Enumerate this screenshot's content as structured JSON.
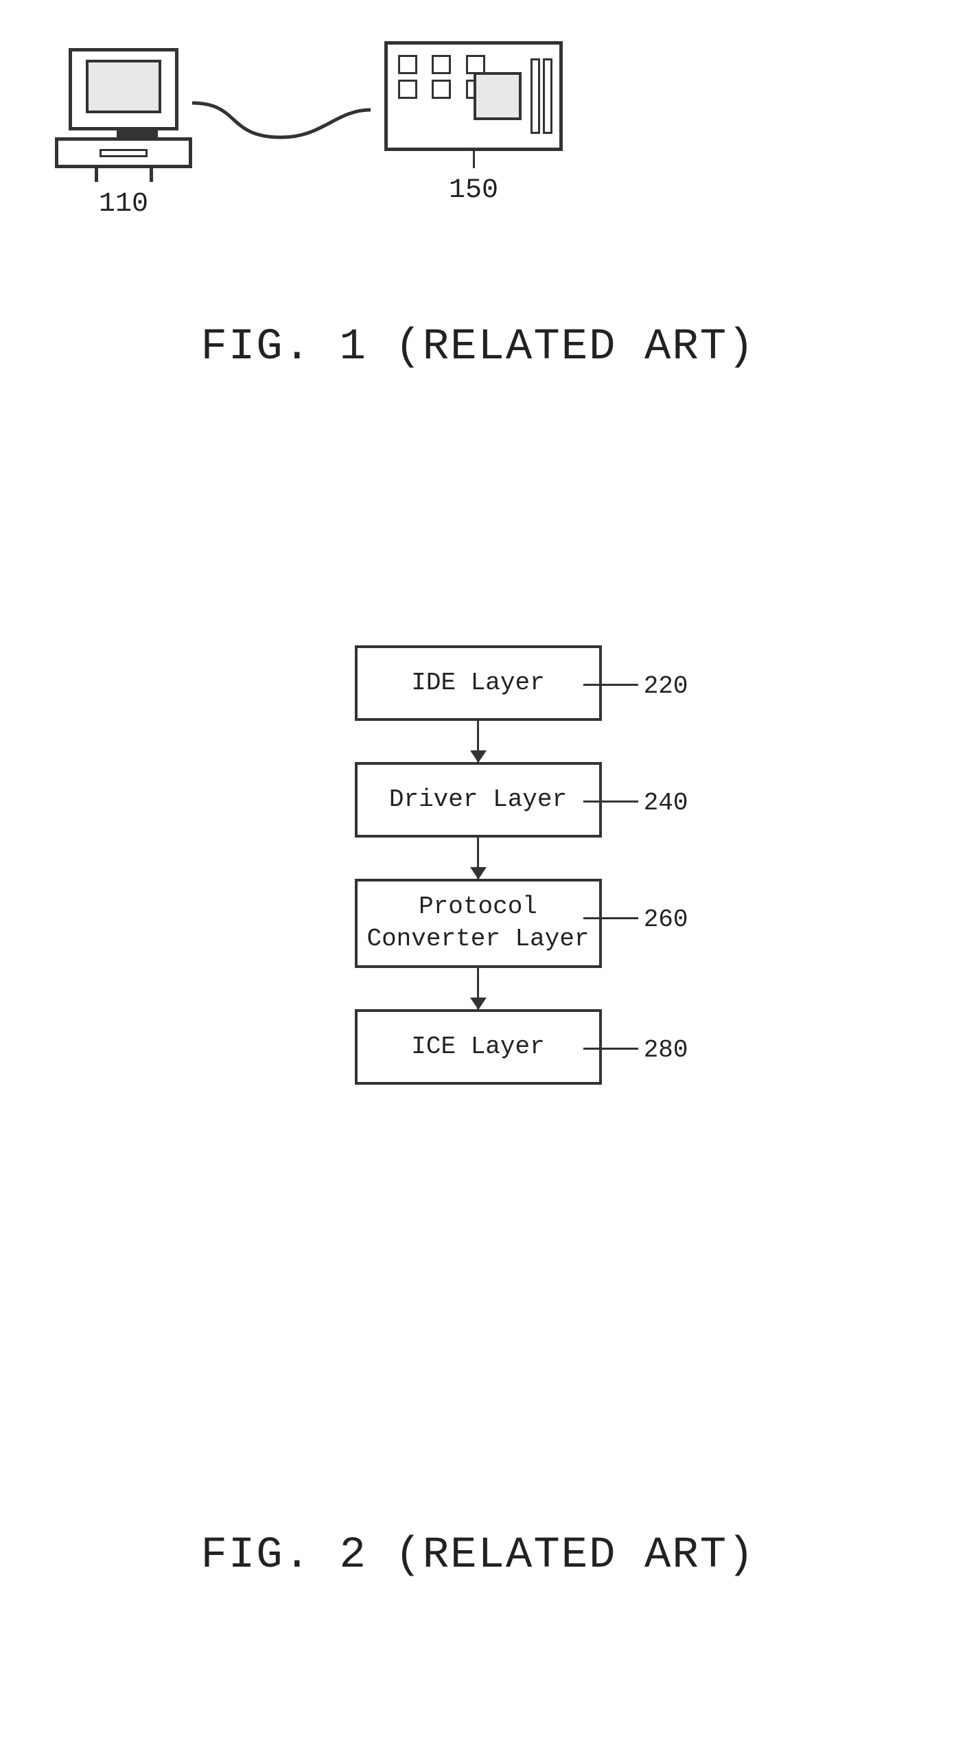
{
  "fig1": {
    "caption": "FIG. 1 (RELATED ART)",
    "device_110_label": "110",
    "device_150_label": "150"
  },
  "fig2": {
    "caption": "FIG. 2 (RELATED ART)",
    "boxes": [
      {
        "id": "ide-layer-box",
        "label": "IDE Layer",
        "ref": "220"
      },
      {
        "id": "driver-layer-box",
        "label": "Driver Layer",
        "ref": "240"
      },
      {
        "id": "protocol-layer-box",
        "label": "Protocol\nConverter Layer",
        "ref": "260"
      },
      {
        "id": "ice-layer-box",
        "label": "ICE Layer",
        "ref": "280"
      }
    ]
  }
}
